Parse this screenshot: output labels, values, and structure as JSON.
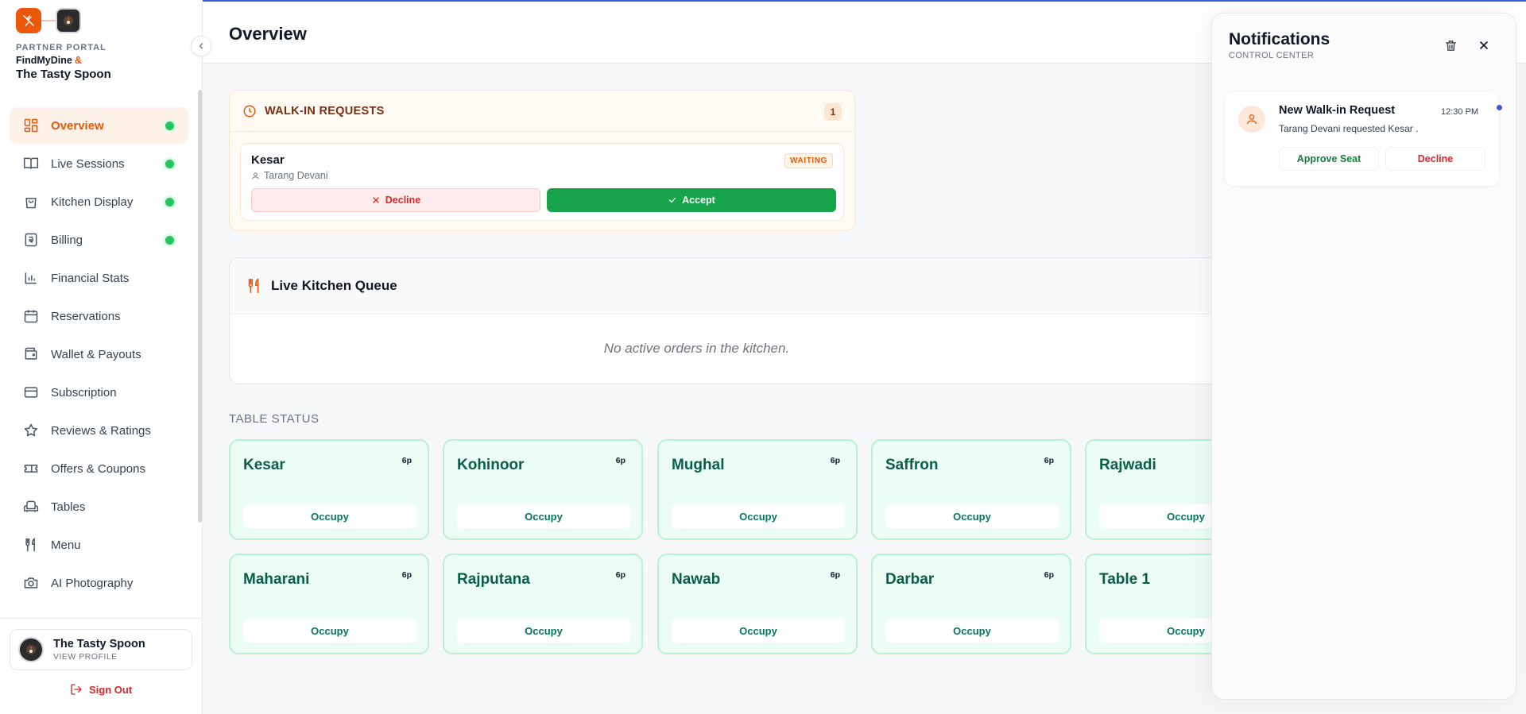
{
  "sidebar": {
    "portal_label": "PARTNER PORTAL",
    "brand_app": "FindMyDine",
    "brand_amp": "&",
    "restaurant_name": "The Tasty Spoon",
    "items": [
      {
        "label": "Overview",
        "icon": "grid-icon",
        "active": true,
        "dot": true
      },
      {
        "label": "Live Sessions",
        "icon": "book-icon",
        "dot": true
      },
      {
        "label": "Kitchen Display",
        "icon": "bag-icon",
        "dot": true
      },
      {
        "label": "Billing",
        "icon": "receipt-icon",
        "dot": true
      },
      {
        "label": "Financial Stats",
        "icon": "bar-chart-icon"
      },
      {
        "label": "Reservations",
        "icon": "calendar-icon"
      },
      {
        "label": "Wallet & Payouts",
        "icon": "wallet-icon"
      },
      {
        "label": "Subscription",
        "icon": "card-icon"
      },
      {
        "label": "Reviews & Ratings",
        "icon": "star-icon"
      },
      {
        "label": "Offers & Coupons",
        "icon": "ticket-icon"
      },
      {
        "label": "Tables",
        "icon": "armchair-icon"
      },
      {
        "label": "Menu",
        "icon": "utensils-icon"
      },
      {
        "label": "AI Photography",
        "icon": "camera-icon"
      }
    ],
    "profile_name": "The Tasty Spoon",
    "profile_sub": "VIEW PROFILE",
    "signout": "Sign Out"
  },
  "header": {
    "title": "Overview"
  },
  "walkin": {
    "title": "WALK-IN REQUESTS",
    "count": "1",
    "request": {
      "table": "Kesar",
      "user": "Tarang Devani",
      "status": "WAITING",
      "decline": "Decline",
      "accept": "Accept"
    }
  },
  "kitchen": {
    "title": "Live Kitchen Queue",
    "empty": "No active orders in the kitchen."
  },
  "table_status": {
    "title": "TABLE STATUS",
    "action": "Occupy",
    "tables": [
      {
        "name": "Kesar",
        "cap": "6p"
      },
      {
        "name": "Kohinoor",
        "cap": "6p"
      },
      {
        "name": "Mughal",
        "cap": "6p"
      },
      {
        "name": "Saffron",
        "cap": "6p"
      },
      {
        "name": "Rajwadi",
        "cap": ""
      },
      {
        "name": "Maharani",
        "cap": "6p"
      },
      {
        "name": "Rajputana",
        "cap": "6p"
      },
      {
        "name": "Nawab",
        "cap": "6p"
      },
      {
        "name": "Darbar",
        "cap": "6p"
      },
      {
        "name": "Table 1",
        "cap": ""
      }
    ]
  },
  "notifications": {
    "title": "Notifications",
    "subtitle": "CONTROL CENTER",
    "items": [
      {
        "title": "New Walk-in Request",
        "time": "12:30 PM",
        "body": "Tarang Devani requested Kesar .",
        "approve": "Approve Seat",
        "decline": "Decline"
      }
    ]
  },
  "colors": {
    "accent": "#ea580c",
    "success": "#16a34a",
    "danger": "#dc2626",
    "unread_dot": "#3b5bdb"
  }
}
